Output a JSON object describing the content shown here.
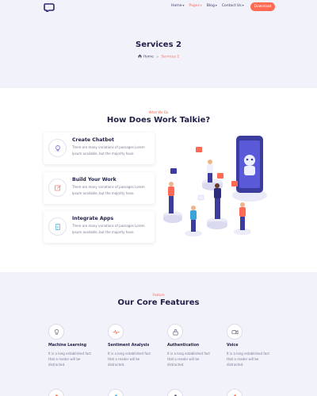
{
  "nav": {
    "items": [
      {
        "label": "Home",
        "active": false
      },
      {
        "label": "Pages",
        "active": true
      },
      {
        "label": "Blog",
        "active": false
      },
      {
        "label": "Contact Us",
        "active": false
      }
    ],
    "download_label": "Download",
    "accent": "#ff6b54"
  },
  "hero": {
    "title": "Services 2",
    "breadcrumb": {
      "home": "Home",
      "separator": ">",
      "current": "Services 2"
    }
  },
  "what": {
    "kicker": "What We Do",
    "title": "How Does Work Talkie?",
    "services": [
      {
        "title": "Create Chatbot",
        "icon": "lightbulb-icon",
        "description": "There are many variations of passages Lorem Ipsum available, but the majority have"
      },
      {
        "title": "Build Your Work",
        "icon": "edit-icon",
        "description": "There are many variations of passages Lorem Ipsum available, but the majority have"
      },
      {
        "title": "Integrate Apps",
        "icon": "clipboard-icon",
        "description": "There are many variations of passages Lorem Ipsum available, but the majority have"
      }
    ]
  },
  "features": {
    "kicker": "Feature",
    "title": "Our Core Features",
    "items": [
      {
        "title": "Machine Learning",
        "icon": "bulb-icon",
        "description": "It is a long established fact that a reader will be distracted."
      },
      {
        "title": "Sentiment Analysis",
        "icon": "pulse-icon",
        "description": "It is a long established fact that a reader will be distracted."
      },
      {
        "title": "Authentication",
        "icon": "lock-icon",
        "description": "It is a long established fact that a reader will be distracted."
      },
      {
        "title": "Voice",
        "icon": "video-icon",
        "description": "It is a long established fact that a reader will be distracted."
      }
    ]
  }
}
